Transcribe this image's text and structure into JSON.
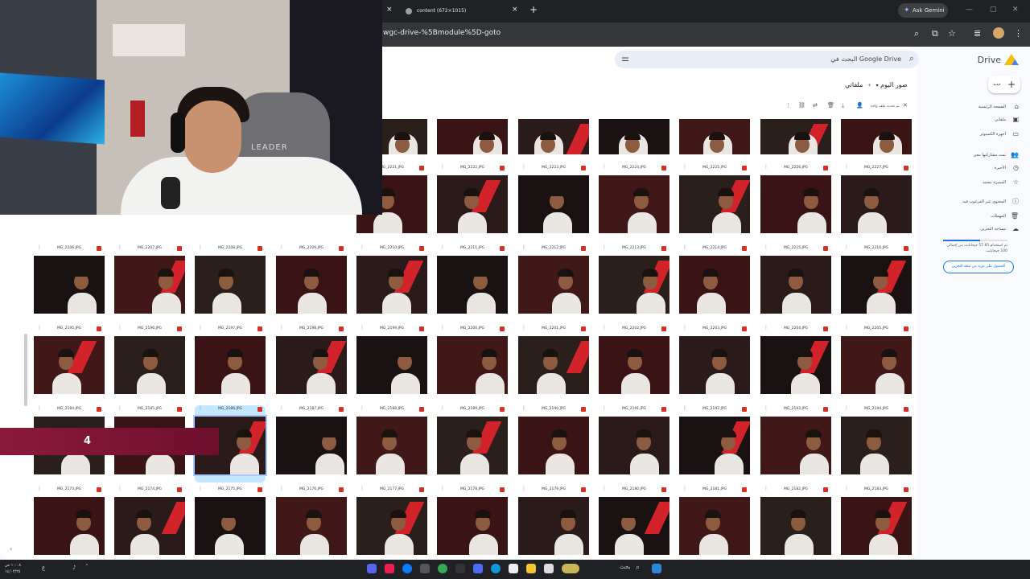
{
  "browser": {
    "tabs": [
      {
        "title": ""
      },
      {
        "title": "content (672×1015)"
      }
    ],
    "new_tab": "+",
    "close": "×",
    "gemini_label": "Ask Gemini",
    "url": "wgc-drive-%5Bmodule%5D-goto"
  },
  "drive": {
    "logo": "Drive",
    "new_button": "جديد",
    "search_placeholder": "البحث في Google Drive",
    "breadcrumb": {
      "root": "ملفاتي",
      "sep": "›",
      "folder": "صور اليوم"
    },
    "selection_text": "تم تحديد ملف واحد",
    "nav": [
      {
        "label": "الصفحة الرئيسية",
        "icon": "⌂"
      },
      {
        "label": "ملفاتي",
        "icon": "▣"
      },
      {
        "label": "أجهزة الكمبيوتر",
        "icon": "▭"
      },
      {
        "label": "تمت مشاركتها معي",
        "icon": "👥"
      },
      {
        "label": "الأخيرة",
        "icon": "◷"
      },
      {
        "label": "المميزة بنجمة",
        "icon": "☆"
      },
      {
        "label": "المحتوى غير المرغوب فيه",
        "icon": "ⓘ"
      },
      {
        "label": "المهملات",
        "icon": "🗑"
      },
      {
        "label": "مساحة التخزين",
        "icon": "☁"
      }
    ],
    "storage_text": "تم استخدام 57.85 جيجابايت من إجمالي 100 جيجابايت",
    "storage_fraction": 0.58,
    "get_storage": "الحصول على مزيد من سعة التخزين"
  },
  "grid_rows": [
    [
      "",
      "",
      "",
      "",
      "",
      "",
      ""
    ],
    [
      "MG_2221.JPG",
      "MG_2222.JPG",
      "MG_2223.JPG",
      "MG_2224.JPG",
      "MG_2225.JPG",
      "MG_2226.JPG",
      "MG_2227.JPG"
    ],
    [
      "MG_2206.JPG",
      "MG_2207.JPG",
      "MG_2208.JPG",
      "MG_2209.JPG",
      "MG_2210.JPG",
      "MG_2211.JPG",
      "MG_2212.JPG",
      "MG_2213.JPG",
      "MG_2214.JPG",
      "MG_2215.JPG",
      "MG_2216.JPG"
    ],
    [
      "MG_2195.JPG",
      "MG_2196.JPG",
      "MG_2197.JPG",
      "MG_2198.JPG",
      "MG_2199.JPG",
      "MG_2200.JPG",
      "MG_2201.JPG",
      "MG_2202.JPG",
      "MG_2203.JPG",
      "MG_2204.JPG",
      "MG_2205.JPG"
    ],
    [
      "MG_2184.JPG",
      "MG_2185.JPG",
      "MG_2186.JPG",
      "MG_2187.JPG",
      "MG_2188.JPG",
      "MG_2189.JPG",
      "MG_2190.JPG",
      "MG_2191.JPG",
      "MG_2192.JPG",
      "MG_2193.JPG",
      "MG_2194.JPG"
    ],
    [
      "MG_2173.JPG",
      "MG_2174.JPG",
      "MG_2175.JPG",
      "MG_2176.JPG",
      "MG_2177.JPG",
      "MG_2178.JPG",
      "MG_2179.JPG",
      "MG_2180.JPG",
      "MG_2181.JPG",
      "MG_2182.JPG",
      "MG_2183.JPG"
    ]
  ],
  "selected_file": "MG_2186.JPG",
  "webcam": {
    "chair_text": "LEADER"
  },
  "overlay": {
    "number": "4"
  },
  "taskbar": {
    "clock_time": "١٠:٠٨ ص",
    "clock_date": "١٤/٠٣/٢٥",
    "search": "بحث"
  }
}
